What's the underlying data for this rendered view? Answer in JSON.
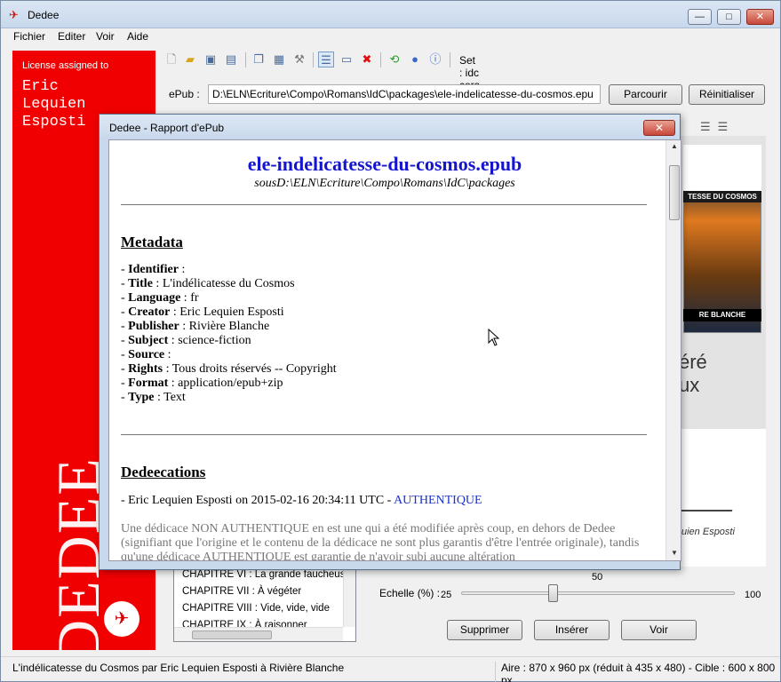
{
  "window": {
    "title": "Dedee",
    "minimize": "—",
    "maximize": "□",
    "close": "✕"
  },
  "menu": [
    "Fichier",
    "Editer",
    "Voir",
    "Aide"
  ],
  "license": {
    "label": "License assigned to",
    "name": "Eric\nLequien\nEsposti",
    "brand": "DEDEE"
  },
  "toolbar": {
    "set_label": "Set : idc cora",
    "icons": [
      "new-file-icon",
      "open-folder-icon",
      "save-icon",
      "save-all-icon",
      "copy-icon",
      "paste-icon",
      "wrench-icon",
      "report-icon",
      "window-icon",
      "delete-icon",
      "refresh-icon",
      "help-icon",
      "info-icon"
    ]
  },
  "epub": {
    "label": "ePub :",
    "path": "D:\\ELN\\Ecriture\\Compo\\Romans\\IdC\\packages\\ele-indelicatesse-du-cosmos.epu",
    "browse_button": "Parcourir",
    "reset_button": "Réinitialiser"
  },
  "cover": {
    "title": "TESSE DU COSMOS",
    "publisher_band": "RE BLANCHE",
    "text1": "éré",
    "text2": "ux",
    "signature_caption": "uien Esposti"
  },
  "chapters": [
    "CHAPITRE VI : La grande faucheuse",
    "CHAPITRE VII : À végéter",
    "CHAPITRE VIII : Vide, vide, vide",
    "CHAPITRE IX : À raisonner"
  ],
  "scale": {
    "label": "Echelle (%) :",
    "min": "25",
    "max": "100",
    "value": "50",
    "value_num": 50
  },
  "actions": {
    "delete": "Supprimer",
    "insert": "Insérer",
    "view": "Voir"
  },
  "status": {
    "left": "L'indélicatesse du Cosmos par Eric Lequien Esposti à Rivière Blanche",
    "right": "Aire : 870 x 960 px (réduit à 435 x 480) - Cible : 600 x 800 px"
  },
  "dialog": {
    "title": "Dedee - Rapport d'ePub",
    "close": "✕",
    "doc_title": "ele-indelicatesse-du-cosmos.epub",
    "doc_subtitle": "sousD:\\ELN\\Ecriture\\Compo\\Romans\\IdC\\packages",
    "metadata_heading": "Metadata",
    "metadata": [
      {
        "key": "Identifier",
        "value": ""
      },
      {
        "key": "Title",
        "value": "L'indélicatesse du Cosmos"
      },
      {
        "key": "Language",
        "value": "fr"
      },
      {
        "key": "Creator",
        "value": "Eric Lequien Esposti"
      },
      {
        "key": "Publisher",
        "value": "Rivière Blanche"
      },
      {
        "key": "Subject",
        "value": "science-fiction"
      },
      {
        "key": "Source",
        "value": ""
      },
      {
        "key": "Rights",
        "value": "Tous droits réservés -- Copyright"
      },
      {
        "key": "Format",
        "value": "application/epub+zip"
      },
      {
        "key": "Type",
        "value": "Text"
      }
    ],
    "dedications_heading": "Dedeecations",
    "dedication_line": "- Eric Lequien Esposti on 2015-02-16 20:34:11 UTC - ",
    "dedication_status": "AUTHENTIQUE",
    "dedication_note": "Une dédicace NON AUTHENTIQUE en est une qui a été modifiée après coup, en dehors de Dedee (signifiant que l'origine et le contenu de la dédicace ne sont plus garantis d'être l'entrée originale), tandis qu'une dédicace AUTHENTIQUE est garantie de n'avoir subi aucune altération"
  }
}
